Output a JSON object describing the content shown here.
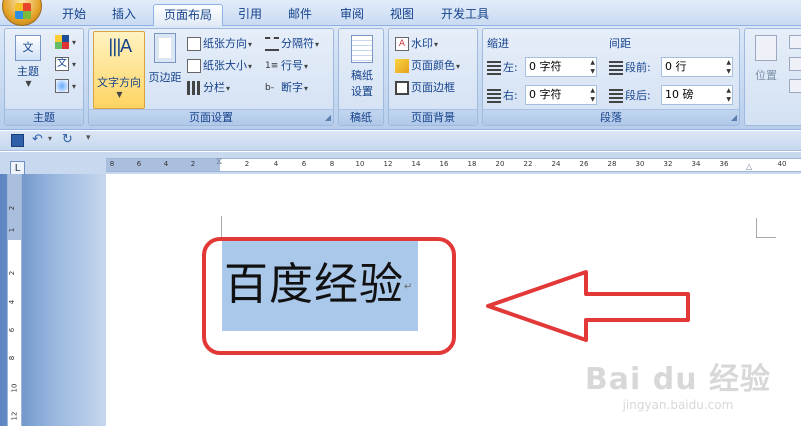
{
  "tabs": [
    "开始",
    "插入",
    "页面布局",
    "引用",
    "邮件",
    "审阅",
    "视图",
    "开发工具"
  ],
  "active_tab": "页面布局",
  "groups": {
    "theme": {
      "label": "主题",
      "theme_button": "主题"
    },
    "page_setup": {
      "label": "页面设置",
      "text_direction": "文字方向",
      "margins": "页边距",
      "orientation": "纸张方向",
      "size": "纸张大小",
      "columns": "分栏",
      "breaks": "分隔符",
      "line_numbers": "行号",
      "hyphenation": "断字"
    },
    "manuscript": {
      "label": "稿纸",
      "button_line1": "稿纸",
      "button_line2": "设置"
    },
    "page_background": {
      "label": "页面背景",
      "watermark": "水印",
      "page_color": "页面颜色",
      "page_borders": "页面边框"
    },
    "paragraph": {
      "label": "段落",
      "indent_title": "缩进",
      "spacing_title": "间距",
      "left_label": "左:",
      "left_value": "0 字符",
      "right_label": "右:",
      "right_value": "0 字符",
      "before_label": "段前:",
      "before_value": "0 行",
      "after_label": "段后:",
      "after_value": "10 磅"
    },
    "arrange": {
      "position": "位置"
    }
  },
  "ruler": {
    "corner": "L",
    "ticks": [
      "8",
      "6",
      "4",
      "2",
      "2",
      "4",
      "6",
      "8",
      "10",
      "12",
      "14",
      "16",
      "18",
      "20",
      "22",
      "24",
      "26",
      "28",
      "30",
      "32",
      "34",
      "36",
      "40"
    ],
    "vticks": [
      "2",
      "1",
      "2",
      "4",
      "6",
      "8",
      "10",
      "12"
    ]
  },
  "document": {
    "text": "百度经验",
    "para_mark": "↵"
  },
  "watermark": {
    "line1": "Bai du 经验",
    "line2": "jingyan.baidu.com"
  },
  "colors": {
    "annotation": "#e33838",
    "selection": "#aac8ea"
  }
}
